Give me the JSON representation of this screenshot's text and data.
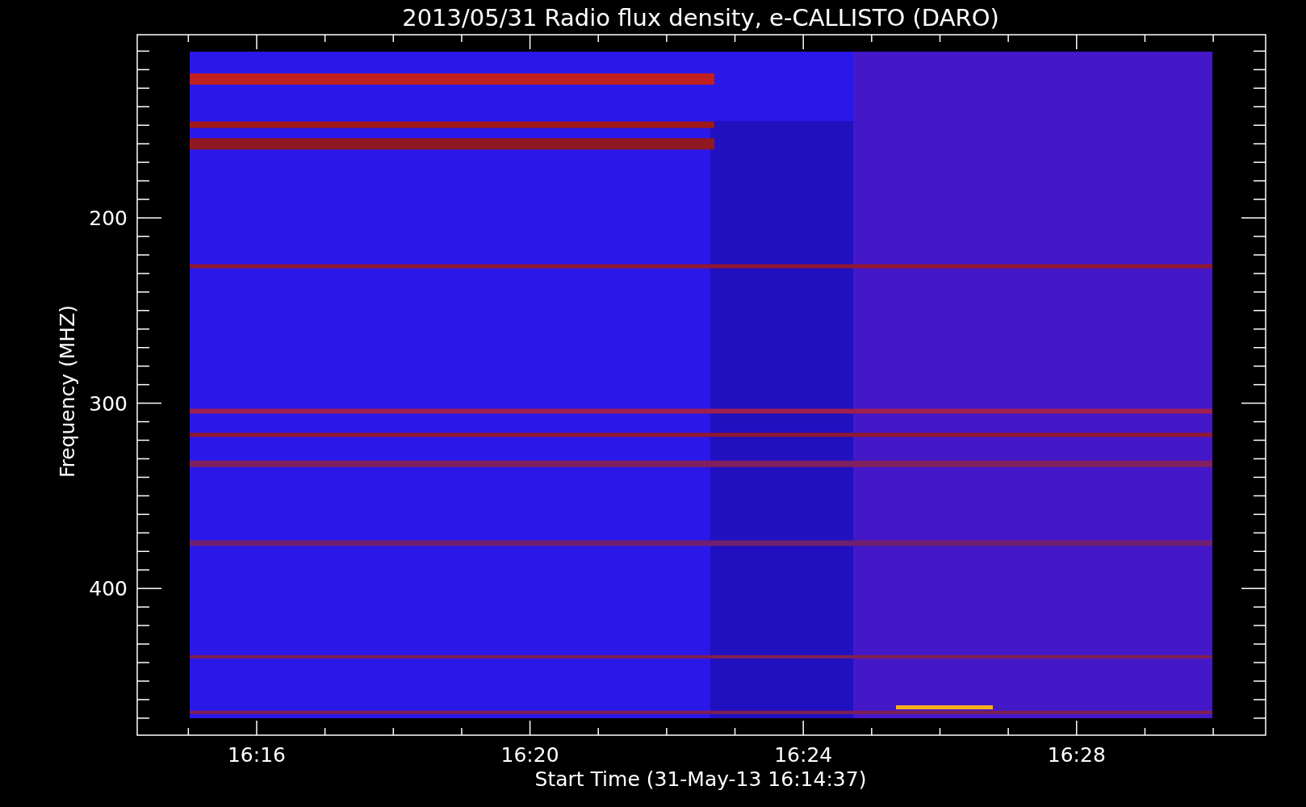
{
  "plot": {
    "title": "2013/05/31  Radio flux density, e-CALLISTO (DARO)",
    "xlabel": "Start Time (31-May-13 16:14:37)",
    "ylabel": "Frequency (MHZ)",
    "xticks": [
      "16:16",
      "16:20",
      "16:24",
      "16:28"
    ],
    "yticks": [
      "200",
      "300",
      "400"
    ]
  }
}
